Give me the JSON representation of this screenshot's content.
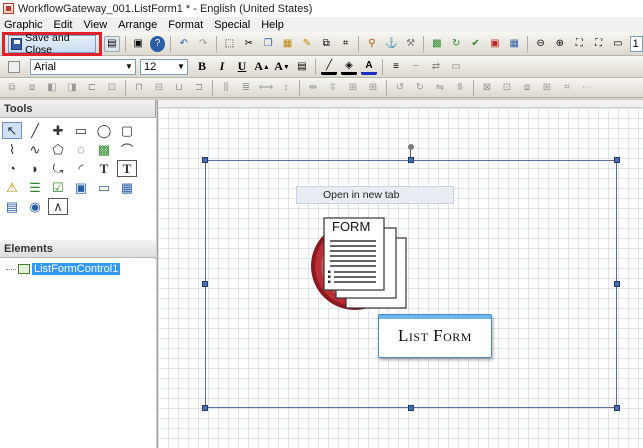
{
  "window": {
    "title": "WorkflowGateway_001.ListForm1 * - English (United States)"
  },
  "menu": [
    "Graphic",
    "Edit",
    "View",
    "Arrange",
    "Format",
    "Special",
    "Help"
  ],
  "toolbar": {
    "save_close_label": "Save and Close",
    "font_name": "Arial",
    "font_size": "12",
    "zoom_partial": "1"
  },
  "tools_panel": {
    "title": "Tools"
  },
  "elements_panel": {
    "title": "Elements",
    "items": [
      {
        "label": "ListFormControl1"
      }
    ]
  },
  "canvas": {
    "context_item": "Open in new tab",
    "form_label": "FORM",
    "list_form_label": "List Form"
  },
  "colors": {
    "highlight_border": "#e0202a",
    "selection": "#3399ff",
    "form_red": "#a8252c"
  }
}
